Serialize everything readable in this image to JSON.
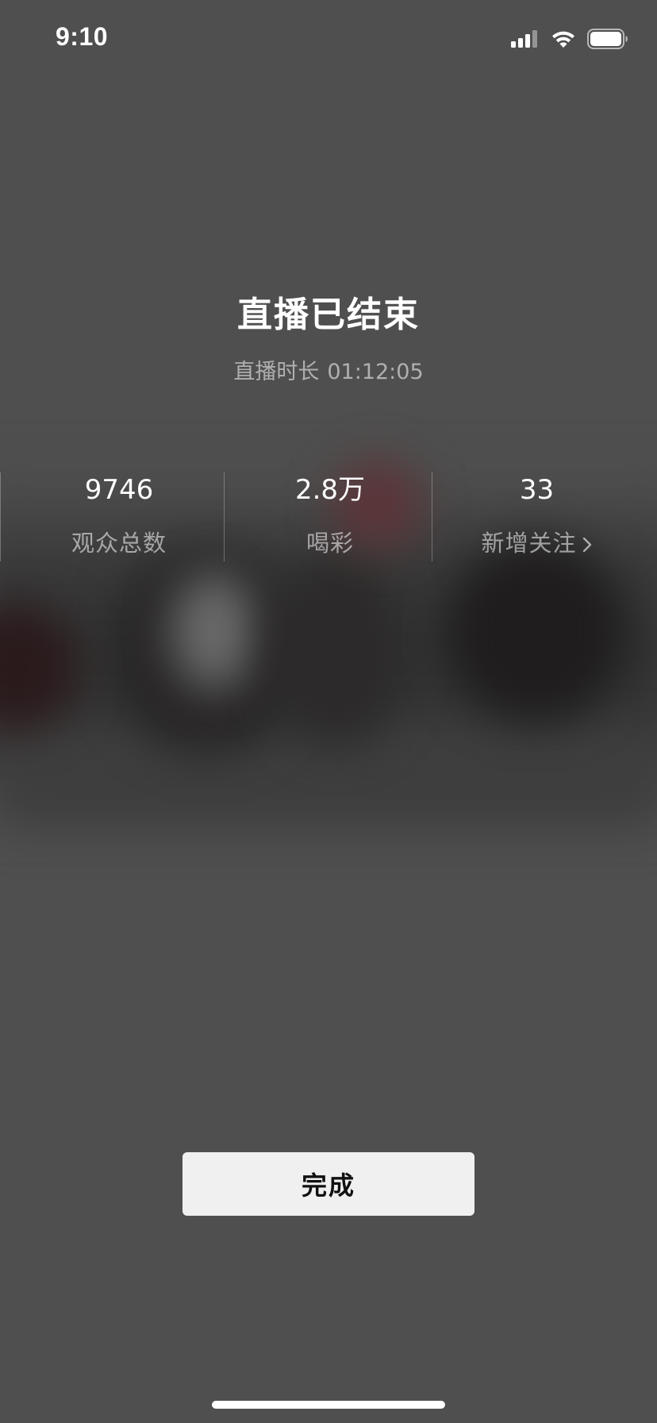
{
  "status_bar": {
    "time": "9:10",
    "icons": [
      "signal-icon",
      "wifi-icon",
      "battery-icon"
    ]
  },
  "live_end": {
    "title": "直播已结束",
    "duration_label": "直播时长",
    "duration_value": "01:12:05"
  },
  "stats": [
    {
      "value": "9746",
      "label": "观众总数"
    },
    {
      "value": "2.8万",
      "label": "喝彩"
    },
    {
      "value": "33",
      "label": "新增关注",
      "icon": "chevron-right-icon"
    }
  ],
  "actions": {
    "done_label": "完成"
  },
  "colors": {
    "background": "#4f4f4f",
    "primary_text": "#ffffff",
    "secondary_text": "#a7a7a7",
    "button_background": "#f0f0f0",
    "button_text": "#111111"
  }
}
